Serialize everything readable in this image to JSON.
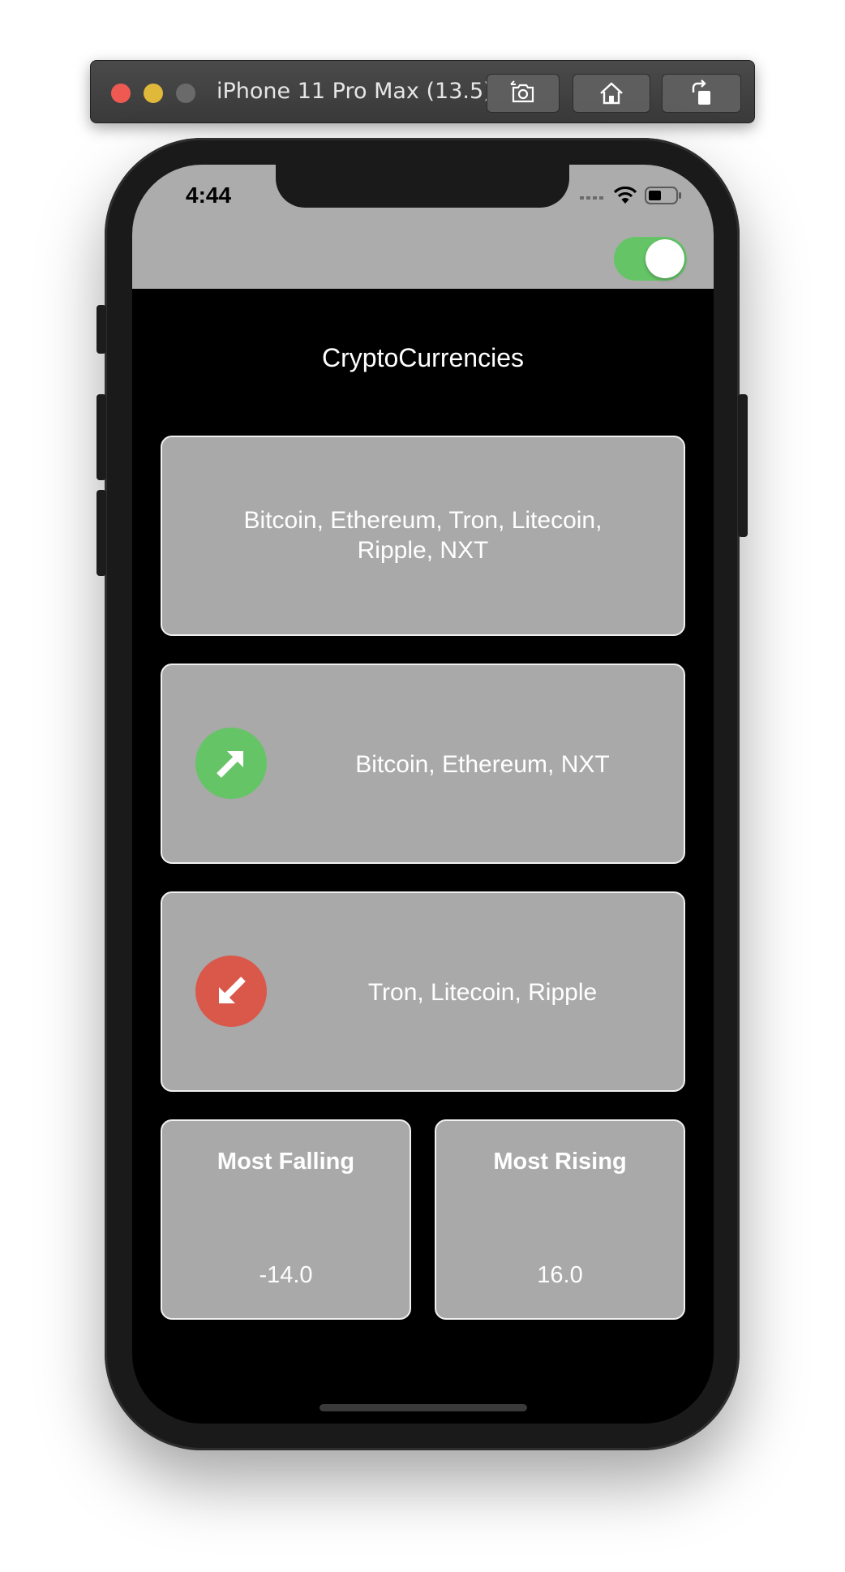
{
  "simulator": {
    "title": "iPhone 11 Pro Max (13.5)",
    "buttons": [
      "screenshot-icon",
      "home-icon",
      "rotate-icon"
    ]
  },
  "status_bar": {
    "time": "4:44",
    "icons": [
      "cellular-icon",
      "wifi-icon",
      "battery-icon"
    ]
  },
  "toggle": {
    "state": "on",
    "color": "#65c466"
  },
  "app": {
    "title": "CryptoCurrencies",
    "all_currencies": "Bitcoin, Ethereum, Tron, Litecoin, Ripple, NXT",
    "rising": {
      "icon": "arrow-up-right-icon",
      "color": "#65c466",
      "text": "Bitcoin, Ethereum, NXT"
    },
    "falling": {
      "icon": "arrow-down-left-icon",
      "color": "#d9584a",
      "text": "Tron, Litecoin, Ripple"
    },
    "most_falling": {
      "label": "Most Falling",
      "value": "-14.0"
    },
    "most_rising": {
      "label": "Most Rising",
      "value": "16.0"
    }
  }
}
